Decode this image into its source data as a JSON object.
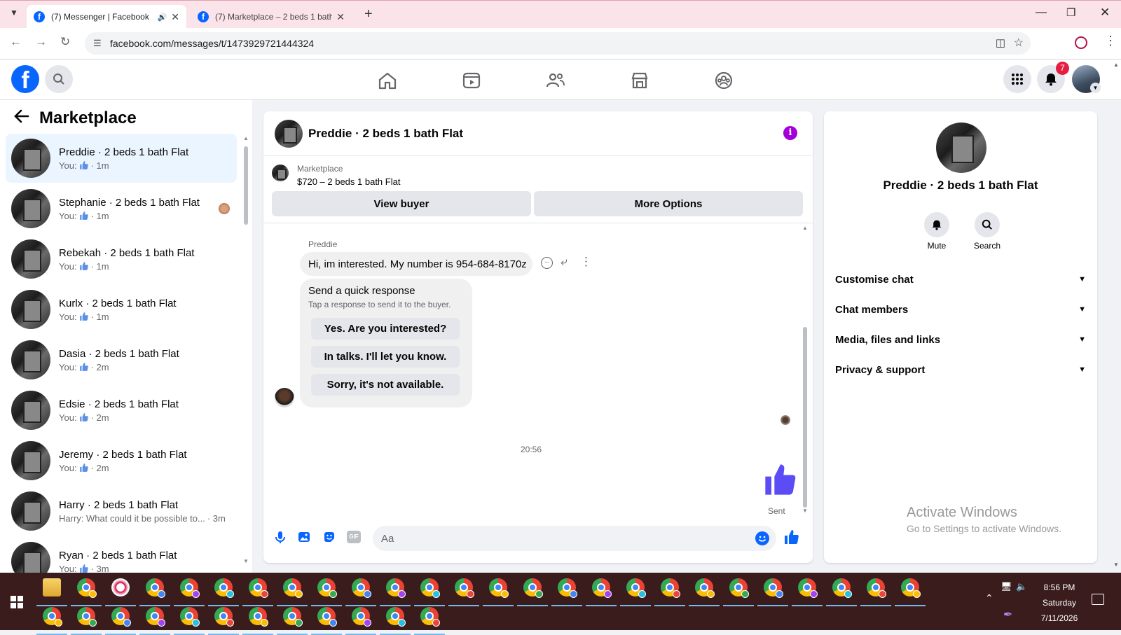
{
  "browser": {
    "tabs": [
      {
        "title": "(7) Messenger | Facebook",
        "active": true,
        "muted_icon": "speaker-icon"
      },
      {
        "title": "(7) Marketplace – 2 beds 1 bath",
        "active": false
      }
    ],
    "url": "facebook.com/messages/t/1473929721444324"
  },
  "header": {
    "notification_count": "7",
    "nav_icons": [
      "home-icon",
      "video-icon",
      "friends-icon",
      "marketplace-icon",
      "groups-icon"
    ]
  },
  "left_panel": {
    "title": "Marketplace",
    "conversations": [
      {
        "name": "Preddie · 2 beds 1 bath Flat",
        "prefix": "You:",
        "time": "· 1m",
        "like": true
      },
      {
        "name": "Stephanie · 2 beds 1 bath Flat",
        "prefix": "You:",
        "time": "· 1m",
        "like": true
      },
      {
        "name": "Rebekah · 2 beds 1 bath Flat",
        "prefix": "You:",
        "time": "· 1m",
        "like": true
      },
      {
        "name": "Kurlx · 2 beds 1 bath Flat",
        "prefix": "You:",
        "time": "· 1m",
        "like": true
      },
      {
        "name": "Dasia · 2 beds 1 bath Flat",
        "prefix": "You:",
        "time": "· 2m",
        "like": true
      },
      {
        "name": "Edsie · 2 beds 1 bath Flat",
        "prefix": "You:",
        "time": "· 2m",
        "like": true
      },
      {
        "name": "Jeremy · 2 beds 1 bath Flat",
        "prefix": "You:",
        "time": "· 2m",
        "like": true
      },
      {
        "name": "Harry · 2 beds 1 bath Flat",
        "prefix": "Harry: What could it be possible to...",
        "time": "· 3m",
        "like": false
      },
      {
        "name": "Ryan · 2 beds 1 bath Flat",
        "prefix": "You:",
        "time": "· 3m",
        "like": true
      }
    ]
  },
  "chat": {
    "title": "Preddie · 2 beds 1 bath Flat",
    "listing_source": "Marketplace",
    "listing": "$720 – 2 beds 1 bath Flat",
    "view_buyer": "View buyer",
    "more_options": "More Options",
    "sender": "Preddie",
    "message": "Hi, im interested. My number is 954-684-8170z",
    "quick_title": "Send a quick response",
    "quick_sub": "Tap a response to send it to the buyer.",
    "quick_responses": [
      "Yes. Are you interested?",
      "In talks. I'll let you know.",
      "Sorry, it's not available."
    ],
    "timestamp": "20:56",
    "sent_label": "Sent",
    "composer_placeholder": "Aa"
  },
  "right_panel": {
    "name": "Preddie · 2 beds 1 bath Flat",
    "mute": "Mute",
    "search": "Search",
    "sections": [
      "Customise chat",
      "Chat members",
      "Media, files and links",
      "Privacy & support"
    ],
    "watermark_title": "Activate Windows",
    "watermark_sub": "Go to Settings to activate Windows."
  },
  "taskbar": {
    "time": "8:56 PM",
    "day": "Saturday",
    "date": "7/11/2026"
  },
  "colors": {
    "fb_blue": "#0866ff",
    "accent_purple": "#5b4cf5",
    "badge_red": "#e41e3f"
  }
}
